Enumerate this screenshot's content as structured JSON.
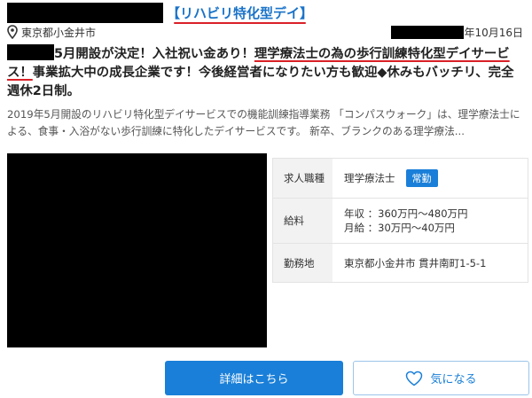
{
  "header": {
    "category_tag": "【リハビリ特化型デイ】",
    "location": "東京都小金井市",
    "date_suffix": "年10月16日"
  },
  "headline": {
    "part1": "5月開設が決定！入社祝い金あり！",
    "part2_highlight": "理学療法士の為の歩行訓練特化型デイサービス！",
    "part3": "事業拡大中の成長企業です！今後経営者になりたい方も歓迎◆休みもバッチリ、完全週休2日制。"
  },
  "description": "2019年5月開設のリハビリ特化型デイサービスでの機能訓練指導業務 「コンパスウォーク」は、理学療法士による、食事・入浴がない歩行訓練に特化したデイサービスです。 新卒、ブランクのある理学療法...",
  "info_table": {
    "job_type_label": "求人職種",
    "job_type_value": "理学療法士",
    "employment_badge": "常勤",
    "salary_label": "給料",
    "salary_annual": "年収 ：360万円〜480万円",
    "salary_monthly": "月給 ：30万円〜40万円",
    "location_label": "勤務地",
    "location_value": "東京都小金井市 貫井南町1-5-1"
  },
  "buttons": {
    "detail_label": "詳細はこちら",
    "favorite_label": "気になる"
  },
  "icons": {
    "location": "map-pin-icon",
    "favorite": "heart-outline-icon"
  },
  "colors": {
    "accent_blue": "#1a7fd8",
    "link_blue": "#1a73c8",
    "underline_red": "#d92027"
  }
}
